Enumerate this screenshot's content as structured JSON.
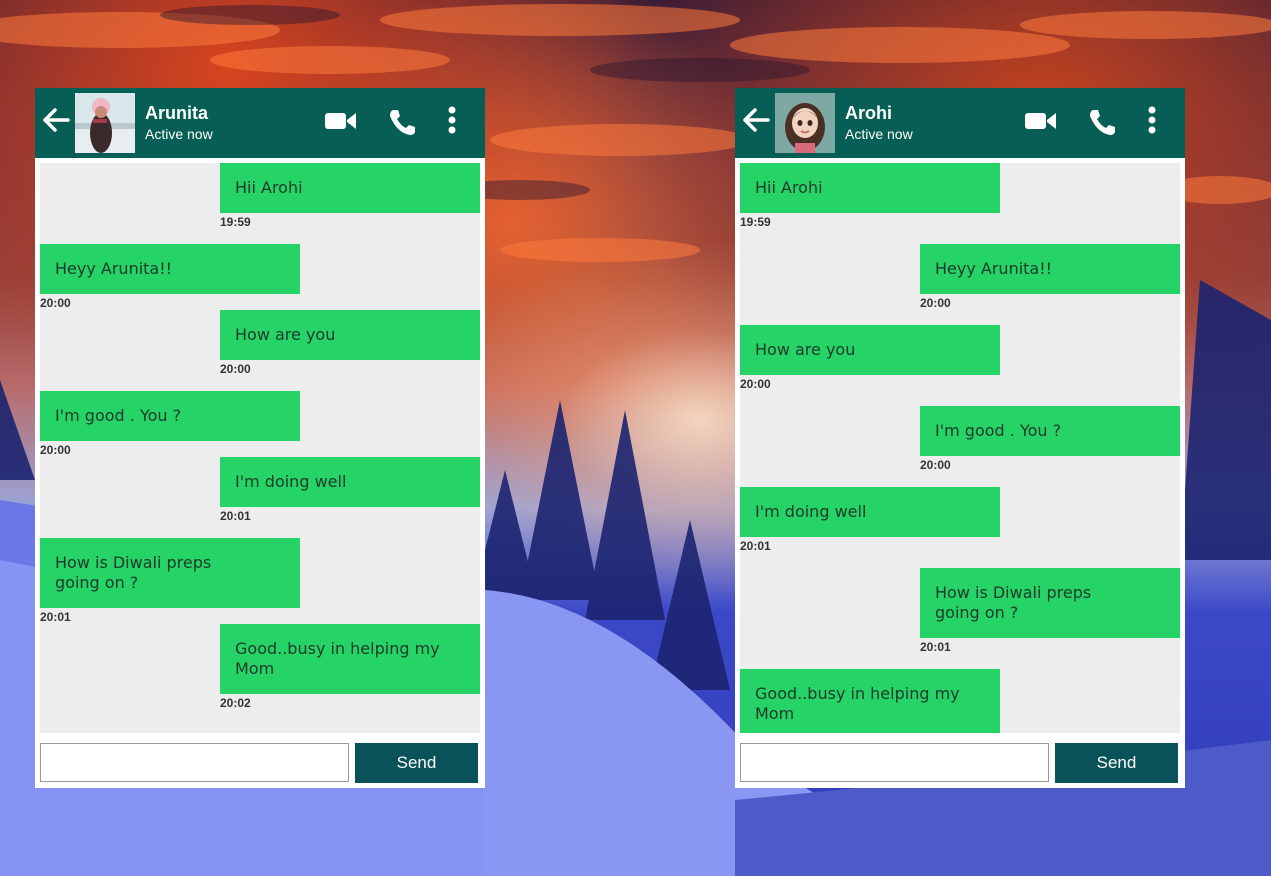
{
  "left_chat": {
    "contact_name": "Arunita",
    "status": "Active now",
    "input_placeholder": "",
    "send_label": "Send",
    "messages": [
      {
        "text": "Hii Arohi",
        "time": "19:59",
        "side": "right"
      },
      {
        "text": "Heyy Arunita!!",
        "time": "20:00",
        "side": "left"
      },
      {
        "text": "How are you",
        "time": "20:00",
        "side": "right"
      },
      {
        "text": "I'm good . You ?",
        "time": "20:00",
        "side": "left"
      },
      {
        "text": "I'm doing well",
        "time": "20:01",
        "side": "right"
      },
      {
        "text": "How is Diwali preps going on ?",
        "time": "20:01",
        "side": "left"
      },
      {
        "text": "Good..busy in helping my Mom",
        "time": "20:02",
        "side": "right"
      }
    ]
  },
  "right_chat": {
    "contact_name": "Arohi",
    "status": "Active now",
    "input_placeholder": "",
    "send_label": "Send",
    "messages": [
      {
        "text": "Hii Arohi",
        "time": "19:59",
        "side": "left"
      },
      {
        "text": "Heyy Arunita!!",
        "time": "20:00",
        "side": "right"
      },
      {
        "text": "How are you",
        "time": "20:00",
        "side": "left"
      },
      {
        "text": "I'm good . You ?",
        "time": "20:00",
        "side": "right"
      },
      {
        "text": "I'm doing well",
        "time": "20:01",
        "side": "left"
      },
      {
        "text": "How is Diwali preps going on ?",
        "time": "20:01",
        "side": "right"
      },
      {
        "text": "Good..busy in helping my Mom",
        "time": "",
        "side": "left"
      }
    ]
  },
  "colors": {
    "header": "#075e54",
    "bubble": "#25d366",
    "send_button": "#0a5259",
    "chat_background": "#ededed"
  },
  "icons": [
    "back-arrow-icon",
    "video-call-icon",
    "phone-call-icon",
    "more-options-icon"
  ]
}
